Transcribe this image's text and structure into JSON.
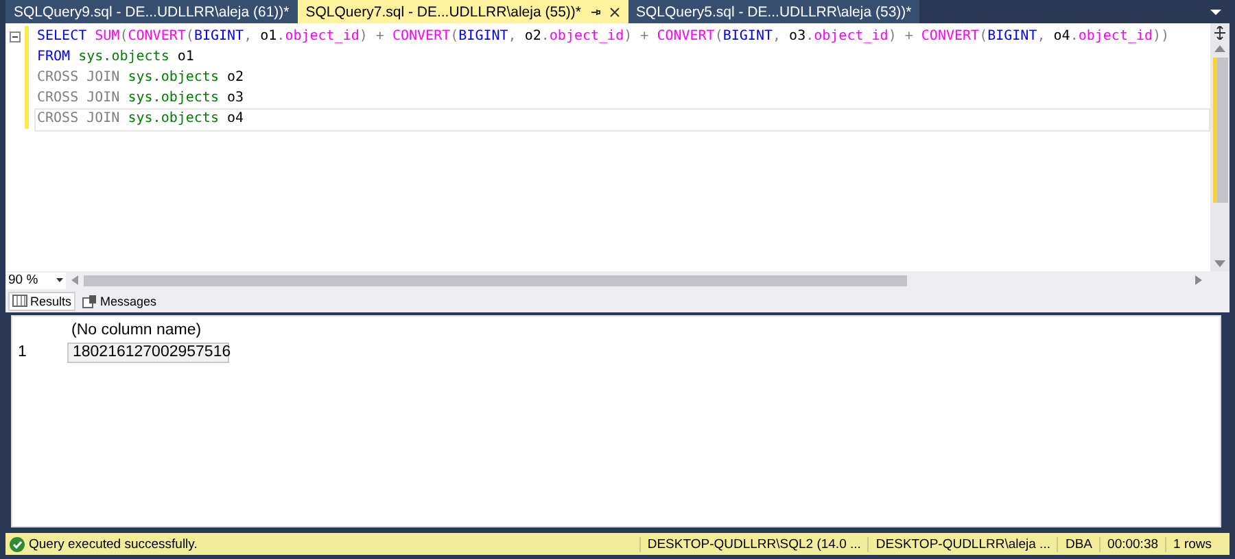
{
  "tabs": [
    {
      "label": "SQLQuery9.sql - DE...UDLLRR\\aleja (61))*",
      "selected": false
    },
    {
      "label": "SQLQuery7.sql - DE...UDLLRR\\aleja (55))*",
      "selected": true
    },
    {
      "label": "SQLQuery5.sql - DE...UDLLRR\\aleja (53))*",
      "selected": false
    }
  ],
  "editor": {
    "lines": [
      {
        "collapsible": true,
        "tokens": [
          {
            "kind": "keyword",
            "text": "SELECT"
          },
          {
            "kind": "function",
            "text": " SUM"
          },
          {
            "kind": "gray",
            "text": "("
          },
          {
            "kind": "function",
            "text": "CONVERT"
          },
          {
            "kind": "gray",
            "text": "("
          },
          {
            "kind": "keyword",
            "text": "BIGINT"
          },
          {
            "kind": "gray",
            "text": ","
          },
          {
            "kind": "plain",
            "text": " o1"
          },
          {
            "kind": "gray",
            "text": "."
          },
          {
            "kind": "function",
            "text": "object_id"
          },
          {
            "kind": "gray",
            "text": ") + "
          },
          {
            "kind": "function",
            "text": "CONVERT"
          },
          {
            "kind": "gray",
            "text": "("
          },
          {
            "kind": "keyword",
            "text": "BIGINT"
          },
          {
            "kind": "gray",
            "text": ","
          },
          {
            "kind": "plain",
            "text": " o2"
          },
          {
            "kind": "gray",
            "text": "."
          },
          {
            "kind": "function",
            "text": "object_id"
          },
          {
            "kind": "gray",
            "text": ") + "
          },
          {
            "kind": "function",
            "text": "CONVERT"
          },
          {
            "kind": "gray",
            "text": "("
          },
          {
            "kind": "keyword",
            "text": "BIGINT"
          },
          {
            "kind": "gray",
            "text": ","
          },
          {
            "kind": "plain",
            "text": " o3"
          },
          {
            "kind": "gray",
            "text": "."
          },
          {
            "kind": "function",
            "text": "object_id"
          },
          {
            "kind": "gray",
            "text": ") + "
          },
          {
            "kind": "function",
            "text": "CONVERT"
          },
          {
            "kind": "gray",
            "text": "("
          },
          {
            "kind": "keyword",
            "text": "BIGINT"
          },
          {
            "kind": "gray",
            "text": ","
          },
          {
            "kind": "plain",
            "text": " o4"
          },
          {
            "kind": "gray",
            "text": "."
          },
          {
            "kind": "function",
            "text": "object_id"
          },
          {
            "kind": "gray",
            "text": "))"
          }
        ]
      },
      {
        "collapsible": false,
        "tokens": [
          {
            "kind": "keyword",
            "text": "FROM"
          },
          {
            "kind": "system",
            "text": " sys.objects"
          },
          {
            "kind": "plain",
            "text": " o1"
          }
        ]
      },
      {
        "collapsible": false,
        "tokens": [
          {
            "kind": "gray",
            "text": "CROSS JOIN"
          },
          {
            "kind": "system",
            "text": " sys.objects"
          },
          {
            "kind": "plain",
            "text": " o2"
          }
        ]
      },
      {
        "collapsible": false,
        "tokens": [
          {
            "kind": "gray",
            "text": "CROSS JOIN"
          },
          {
            "kind": "system",
            "text": " sys.objects"
          },
          {
            "kind": "plain",
            "text": " o3"
          }
        ]
      },
      {
        "collapsible": false,
        "tokens": [
          {
            "kind": "gray",
            "text": "CROSS JOIN"
          },
          {
            "kind": "system",
            "text": " sys.objects"
          },
          {
            "kind": "plain",
            "text": " o4"
          }
        ]
      }
    ]
  },
  "zoom": {
    "value": "90 %"
  },
  "results_tabs": [
    {
      "label": "Results",
      "selected": true
    },
    {
      "label": "Messages",
      "selected": false
    }
  ],
  "grid": {
    "columns": [
      "(No column name)"
    ],
    "rows": [
      {
        "number": "1",
        "cells": [
          "180216127002957516"
        ]
      }
    ]
  },
  "status_bar": {
    "message": "Query executed successfully.",
    "server": "DESKTOP-QUDLLRR\\SQL2 (14.0 ...",
    "user": "DESKTOP-QUDLLRR\\aleja ...",
    "database": "DBA",
    "duration": "00:00:38",
    "rows": "1 rows"
  }
}
